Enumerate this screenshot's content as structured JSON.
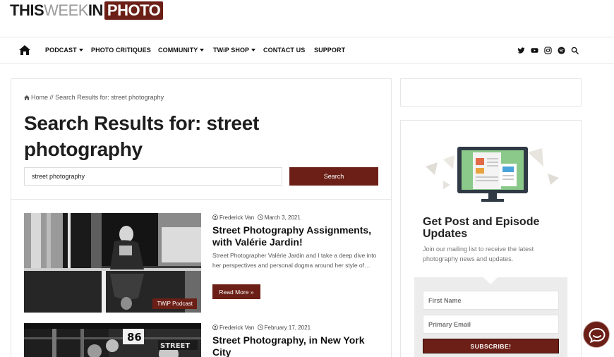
{
  "logo": {
    "part1": "THIS",
    "part2": "WEEK",
    "part3": "IN",
    "part4": "PHOTO"
  },
  "nav": {
    "items": [
      {
        "label": "PODCAST",
        "dropdown": true
      },
      {
        "label": "PHOTO CRITIQUES",
        "dropdown": false
      },
      {
        "label": "COMMUNITY",
        "dropdown": true
      },
      {
        "label": "TWiP SHOP",
        "dropdown": true
      },
      {
        "label": "CONTACT US",
        "dropdown": false
      },
      {
        "label": "SUPPORT",
        "dropdown": false
      }
    ],
    "social_icons": [
      "twitter-icon",
      "youtube-icon",
      "instagram-icon",
      "spotify-icon",
      "search-icon"
    ]
  },
  "breadcrumb": {
    "home": "Home",
    "separator": "//",
    "current": "Search Results for: street photography"
  },
  "search": {
    "title": "Search Results for: street photography",
    "value": "street photography",
    "button": "Search"
  },
  "posts": [
    {
      "author": "Frederick Van",
      "date": "March 3, 2021",
      "title": "Street Photography Assignments, with Valérie Jardin!",
      "excerpt": "Street Photographer Valérie Jardin and I take a deep dive into her perspectives and personal dogma around her style of…",
      "badge": "TWiP Podcast",
      "read_more": "Read More »"
    },
    {
      "author": "Frederick Van",
      "date": "February 17, 2021",
      "title": "Street Photography, in New York City"
    }
  ],
  "sidebar": {
    "title": "Get Post and Episode Updates",
    "description": "Join our mailing list to receive the latest photography news and updates.",
    "first_name_placeholder": "First Name",
    "email_placeholder": "Primary Email",
    "subscribe": "SUBSCRIBE!"
  },
  "colors": {
    "brand": "#6b1f16",
    "border": "#e6e6e6"
  }
}
